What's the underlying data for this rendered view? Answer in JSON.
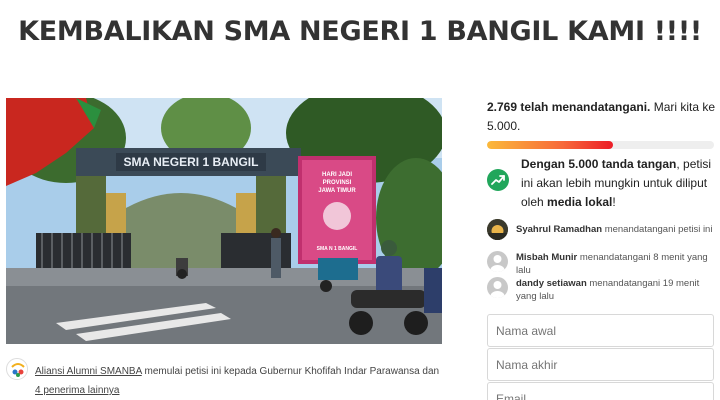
{
  "title": "KEMBALIKAN SMA NEGERI 1 BANGIL KAMI !!!!",
  "hero": {
    "gate_sign": "SMA NEGERI 1 BANGIL",
    "banner_lines": [
      "HARI JADI",
      "PROVINSI",
      "JAWA TIMUR"
    ],
    "banner_footer": "SMA N 1 BANGIL"
  },
  "starter": {
    "name": "Aliansi Alumni SMANBA",
    "action": " memulai petisi ini kepada Gubernur Khofifah Indar Parawansa dan ",
    "others": "4 penerima lainnya"
  },
  "signatures": {
    "count_text": "2.769 telah menandatangani.",
    "goal_text": " Mari kita ke 5.000.",
    "signed": 2769,
    "goal": 5000
  },
  "media": {
    "bold_lead": "Dengan 5.000 tanda tangan",
    "middle": ", petisi ini akan lebih mungkin untuk diliput oleh ",
    "bold_tail": "media lokal",
    "end": "!"
  },
  "recent_signers": [
    {
      "name": "Syahrul Ramadhan",
      "action": " menandatangani petisi ini"
    },
    {
      "name": "Misbah Munir",
      "action": " menandatangani 8 menit yang lalu"
    },
    {
      "name": "dandy setiawan",
      "action": " menandatangani 19 menit yang lalu"
    }
  ],
  "form": {
    "first_name_placeholder": "Nama awal",
    "last_name_placeholder": "Nama akhir",
    "email_placeholder": "Email"
  },
  "colors": {
    "progress_start": "#fbb93b",
    "progress_end": "#ec1d27",
    "media_icon": "#21a65b"
  },
  "icons": {
    "media": "trending-up-icon",
    "signer_avatar": "user-icon",
    "starter_avatar": "alumni-logo"
  }
}
